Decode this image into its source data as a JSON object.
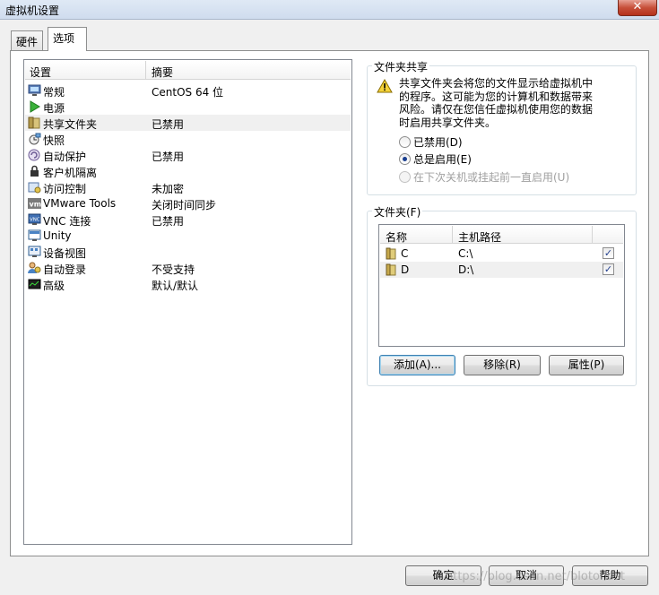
{
  "window": {
    "title": "虚拟机设置",
    "close_label": "✕"
  },
  "tabs": [
    {
      "label": "硬件"
    },
    {
      "label": "选项"
    }
  ],
  "settings_list": {
    "col_setting": "设置",
    "col_summary": "摘要",
    "rows": [
      {
        "icon": "monitor-icon",
        "label": "常规",
        "summary": "CentOS 64 位"
      },
      {
        "icon": "power-icon",
        "label": "电源",
        "summary": ""
      },
      {
        "icon": "shared-folder-icon",
        "label": "共享文件夹",
        "summary": "已禁用"
      },
      {
        "icon": "snapshot-icon",
        "label": "快照",
        "summary": ""
      },
      {
        "icon": "autoprotect-icon",
        "label": "自动保护",
        "summary": "已禁用"
      },
      {
        "icon": "lock-icon",
        "label": "客户机隔离",
        "summary": ""
      },
      {
        "icon": "access-control-icon",
        "label": "访问控制",
        "summary": "未加密"
      },
      {
        "icon": "vmware-tools-icon",
        "label": "VMware Tools",
        "summary": "关闭时间同步"
      },
      {
        "icon": "vnc-icon",
        "label": "VNC 连接",
        "summary": "已禁用"
      },
      {
        "icon": "unity-icon",
        "label": "Unity",
        "summary": ""
      },
      {
        "icon": "device-view-icon",
        "label": "设备视图",
        "summary": ""
      },
      {
        "icon": "autologin-icon",
        "label": "自动登录",
        "summary": "不受支持"
      },
      {
        "icon": "advanced-icon",
        "label": "高级",
        "summary": "默认/默认"
      }
    ]
  },
  "folder_sharing": {
    "title": "文件夹共享",
    "warning_lines": [
      "共享文件夹会将您的文件显示给虚拟机中",
      "的程序。这可能为您的计算机和数据带来",
      "风险。请仅在您信任虚拟机使用您的数据",
      "时启用共享文件夹。"
    ],
    "options": [
      {
        "label": "已禁用(D)",
        "checked": false,
        "disabled": false
      },
      {
        "label": "总是启用(E)",
        "checked": true,
        "disabled": false
      },
      {
        "label": "在下次关机或挂起前一直启用(U)",
        "checked": false,
        "disabled": true
      }
    ]
  },
  "folders": {
    "title": "文件夹(F)",
    "col_name": "名称",
    "col_path": "主机路径",
    "rows": [
      {
        "name": "C",
        "path": "C:\\",
        "enabled": true
      },
      {
        "name": "D",
        "path": "D:\\",
        "enabled": true
      }
    ],
    "check_mark": "✓",
    "add_label": "添加(A)...",
    "remove_label": "移除(R)",
    "properties_label": "属性(P)"
  },
  "footer": {
    "ok_label": "确定",
    "cancel_label": "取消",
    "help_label": "帮助"
  },
  "watermark": "https://blog.csdn.net/blotohost"
}
